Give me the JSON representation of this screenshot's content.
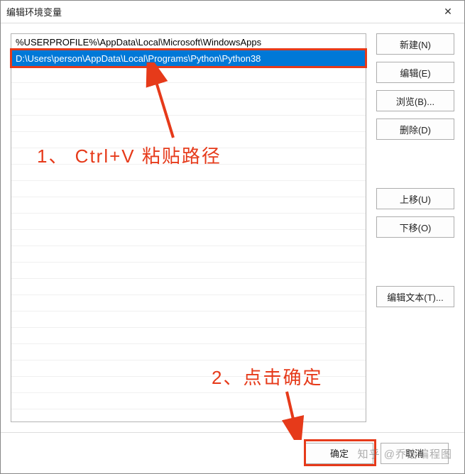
{
  "window": {
    "title": "编辑环境变量"
  },
  "list": {
    "items": [
      {
        "text": "%USERPROFILE%\\AppData\\Local\\Microsoft\\WindowsApps",
        "selected": false
      },
      {
        "text": "D:\\Users\\person\\AppData\\Local\\Programs\\Python\\Python38",
        "selected": true
      }
    ]
  },
  "buttons": {
    "new": "新建(N)",
    "edit": "编辑(E)",
    "browse": "浏览(B)...",
    "delete": "删除(D)",
    "moveUp": "上移(U)",
    "moveDown": "下移(O)",
    "editText": "编辑文本(T)...",
    "ok": "确定",
    "cancel": "取消"
  },
  "annotations": {
    "step1": "1、 Ctrl+V 粘贴路径",
    "step2": "2、点击确定"
  },
  "watermark": "知乎 @乔治编程图"
}
